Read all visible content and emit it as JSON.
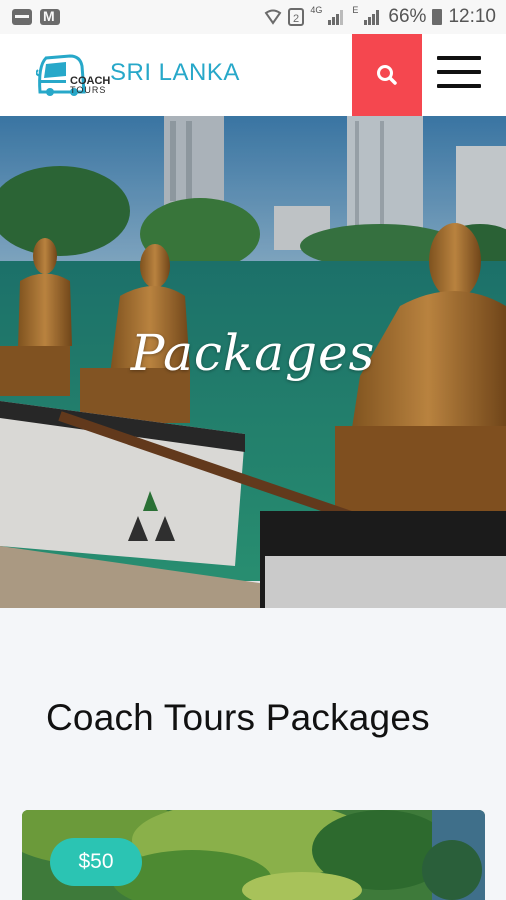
{
  "status_bar": {
    "network_4g": "4G",
    "network_e": "E",
    "battery_percent": "66%",
    "time": "12:10"
  },
  "header": {
    "logo_line1": "COACH",
    "logo_line2": "TOURS",
    "brand": "SRI LANKA",
    "brand_color": "#27a8c9",
    "search_color": "#f5474f"
  },
  "hero": {
    "title": "Packages"
  },
  "main": {
    "section_title": "Coach Tours Packages",
    "packages": [
      {
        "price": "$50"
      }
    ],
    "badge_color": "#2bc4b3"
  }
}
